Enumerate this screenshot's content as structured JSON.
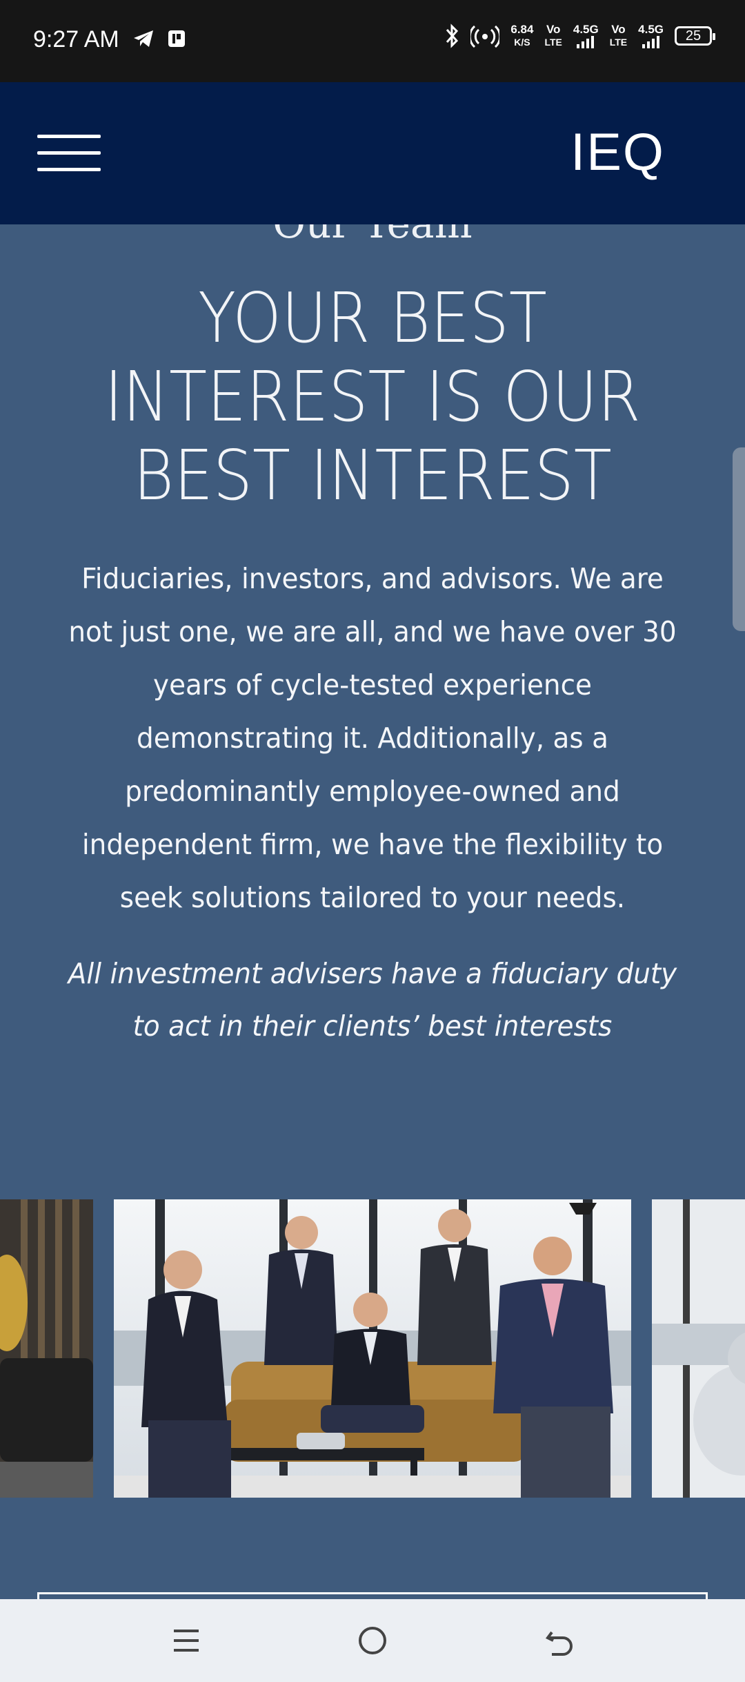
{
  "status_bar": {
    "time": "9:27 AM",
    "net_speed_value": "6.84",
    "net_speed_unit": "K/S",
    "sim1_top": "Vo",
    "sim1_bottom": "LTE",
    "sim1_gen": "4.5G",
    "sim2_top": "Vo",
    "sim2_bottom": "LTE",
    "sim2_gen": "4.5G",
    "battery": "25",
    "icons": [
      "telegram-icon",
      "app-notification-icon",
      "bluetooth-icon",
      "hotspot-icon",
      "signal-icon",
      "battery-icon"
    ]
  },
  "header": {
    "brand": "IEQ",
    "menu_icon": "hamburger-menu-icon",
    "background": "#031c4a"
  },
  "main": {
    "section_label": "Our Team",
    "headline_lines": [
      "YOUR BEST",
      "INTEREST IS OUR",
      "BEST INTEREST"
    ],
    "body": "Fiduciaries, investors, and advisors. We are not just one, we are all, and we have over 30 years of cycle-tested experience demonstrating it. Additionally, as a predominantly employee-owned and independent firm, we have the flexibility to seek solutions tailored to your needs.",
    "italic_note": "All investment advisers have a fiduciary duty to act in their clients’ best interests",
    "background": "#3f5b7d"
  },
  "carousel": {
    "slides": [
      "partial-slide-left",
      "team-photo",
      "partial-slide-right"
    ]
  },
  "nav_bar": {
    "icons": [
      "recent-apps-icon",
      "home-icon",
      "back-icon"
    ]
  }
}
